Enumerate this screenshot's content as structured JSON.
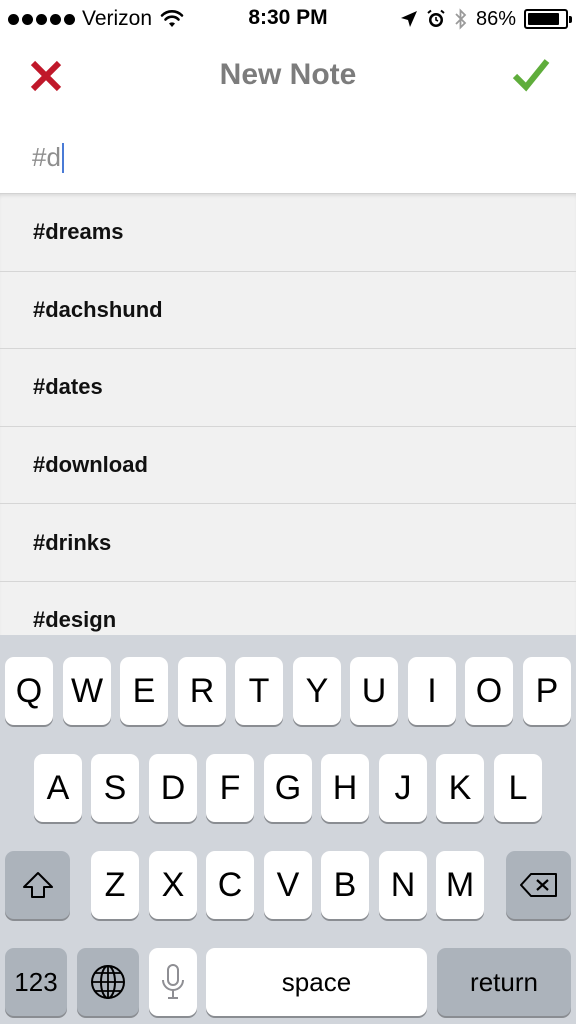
{
  "status_bar": {
    "carrier": "Verizon",
    "time": "8:30 PM",
    "battery_percent": "86%",
    "battery_level": 0.86
  },
  "nav": {
    "title": "New Note",
    "close_icon": "close-x-icon",
    "done_icon": "checkmark-icon",
    "close_color": "#c0182a",
    "done_color": "#5fad3b"
  },
  "note_input": {
    "value": "#d"
  },
  "suggestions": [
    "#dreams",
    "#dachshund",
    "#dates",
    "#download",
    "#drinks",
    "#design"
  ],
  "keyboard": {
    "row1": [
      "Q",
      "W",
      "E",
      "R",
      "T",
      "Y",
      "U",
      "I",
      "O",
      "P"
    ],
    "row2": [
      "A",
      "S",
      "D",
      "F",
      "G",
      "H",
      "J",
      "K",
      "L"
    ],
    "row3": [
      "Z",
      "X",
      "C",
      "V",
      "B",
      "N",
      "M"
    ],
    "numbers_label": "123",
    "space_label": "space",
    "return_label": "return",
    "shift_icon": "shift-icon",
    "delete_icon": "backspace-icon",
    "globe_icon": "globe-icon",
    "mic_icon": "microphone-icon"
  }
}
